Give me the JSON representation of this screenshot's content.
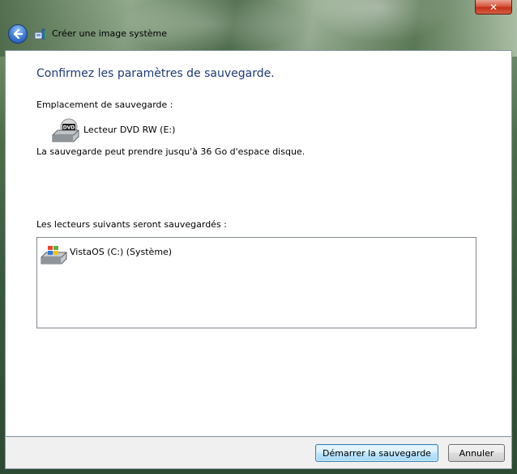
{
  "window": {
    "title": "Créer une image système",
    "close_symbol": "✕"
  },
  "main": {
    "heading": "Confirmez les paramètres de sauvegarde.",
    "location_label": "Emplacement de sauvegarde :",
    "location_drive": "Lecteur DVD RW (E:)",
    "location_drive_icon": "dvd-drive-icon",
    "space_note": "La sauvegarde peut prendre jusqu'à 36 Go d'espace disque.",
    "drives_label": "Les lecteurs suivants seront sauvegardés :",
    "drives": [
      {
        "label": "VistaOS (C:) (Système)",
        "icon": "windows-drive-icon"
      }
    ]
  },
  "footer": {
    "start_label": "Démarrer la sauvegarde",
    "cancel_label": "Annuler"
  },
  "colors": {
    "heading": "#1e3a78",
    "accent_button_border": "#3c7fb1",
    "close_button": "#c2321a"
  }
}
